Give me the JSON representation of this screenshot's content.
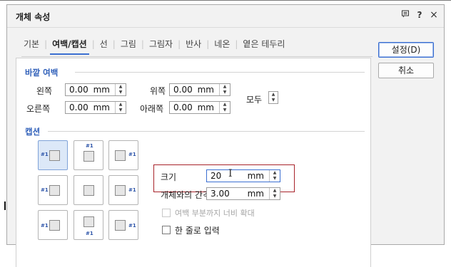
{
  "window": {
    "title": "개체 속성",
    "help_label": "?",
    "close_label": "×"
  },
  "tabs": [
    {
      "label": "기본"
    },
    {
      "label": "여백/캡션"
    },
    {
      "label": "선"
    },
    {
      "label": "그림"
    },
    {
      "label": "그림자"
    },
    {
      "label": "반사"
    },
    {
      "label": "네온"
    },
    {
      "label": "옅은 테두리"
    }
  ],
  "outer_margin": {
    "title": "바깥 여백",
    "left_label": "왼쪽",
    "left_value": "0.00",
    "right_label": "오른쪽",
    "right_value": "0.00",
    "top_label": "위쪽",
    "top_value": "0.00",
    "bottom_label": "아래쪽",
    "bottom_value": "0.00",
    "unit": "mm",
    "all_label": "모두"
  },
  "caption": {
    "title": "캡션",
    "tag": "#1",
    "size_label": "크기",
    "size_value": "20",
    "gap_label": "개체와의 간격",
    "gap_value": "3.00",
    "unit": "mm",
    "expand_label": "여백 부분까지 너비 확대",
    "single_line_label": "한 줄로 입력"
  },
  "buttons": {
    "ok_label": "설정(D)",
    "cancel_label": "취소"
  },
  "colors": {
    "accent": "#3b6fd1",
    "highlight_border": "#a8232a",
    "selected_bg": "#dce8f8"
  }
}
